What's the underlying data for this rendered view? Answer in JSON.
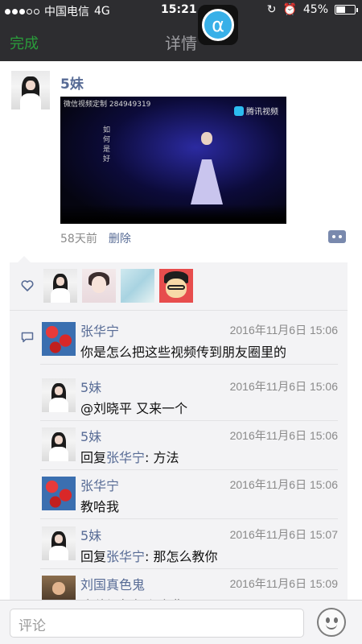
{
  "status_bar": {
    "carrier": "中国电信",
    "network": "4G",
    "time": "15:21",
    "battery": "45%",
    "battery_level": 0.45
  },
  "nav": {
    "done_label": "完成",
    "title": "详情",
    "badge_symbol": "α"
  },
  "post": {
    "author": "5妹",
    "video_watermark": "微信视频定制 284949319",
    "video_logo": "腾讯视频",
    "video_caption": "如何是好",
    "time": "58天前",
    "delete_label": "删除"
  },
  "comments": [
    {
      "name": "张华宁",
      "time": "2016年11月6日 15:06",
      "text": "你是怎么把这些视频传到朋友圈里的"
    },
    {
      "name": "5妹",
      "time": "2016年11月6日 15:06",
      "text": "@刘晓平 又来一个"
    },
    {
      "name": "5妹",
      "time": "2016年11月6日 15:06",
      "prefix": "回复",
      "reply_to": "张华宁",
      "text": ": 方法"
    },
    {
      "name": "张华宁",
      "time": "2016年11月6日 15:06",
      "text": "教哈我"
    },
    {
      "name": "5妹",
      "time": "2016年11月6日 15:07",
      "prefix": "回复",
      "reply_to": "张华宁",
      "text": ": 那怎么教你"
    },
    {
      "name": "刘国真色鬼",
      "time": "2016年11月6日 15:09",
      "text": "这种视频怎么会费运"
    }
  ],
  "input": {
    "placeholder": "评论"
  },
  "colors": {
    "accent_green": "#2a9d3b",
    "link_blue": "#576b95",
    "header_bg": "#2d2d30"
  }
}
